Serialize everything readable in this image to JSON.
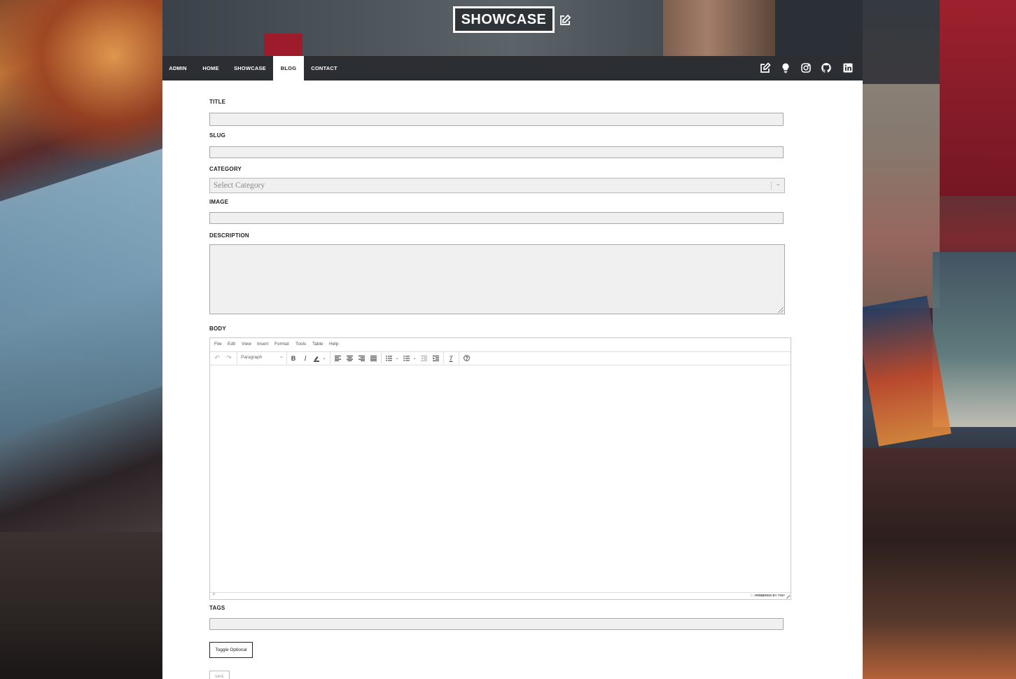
{
  "brand": {
    "title": "SHOWCASE"
  },
  "nav": {
    "items": [
      {
        "label": "ADMIN"
      },
      {
        "label": "HOME"
      },
      {
        "label": "SHOWCASE"
      },
      {
        "label": "BLOG",
        "active": true
      },
      {
        "label": "CONTACT"
      }
    ],
    "icons": [
      "edit-icon",
      "lightbulb-icon",
      "instagram-icon",
      "github-icon",
      "linkedin-icon"
    ]
  },
  "form": {
    "title_label": "TITLE",
    "slug_label": "SLUG",
    "category_label": "CATEGORY",
    "category_placeholder": "Select Category",
    "image_label": "IMAGE",
    "description_label": "DESCRIPTION",
    "body_label": "BODY",
    "tags_label": "TAGS",
    "toggle_button": "Toggle Optional",
    "submit_button": "SAVE"
  },
  "editor": {
    "menu": [
      "File",
      "Edit",
      "View",
      "Insert",
      "Format",
      "Tools",
      "Table",
      "Help"
    ],
    "format_select": "Paragraph",
    "status_path": "P",
    "word_count": "0 WORDS",
    "powered_by": "POWERED BY TINY"
  },
  "colors": {
    "nav_bg": "#282a2e",
    "panel_bg": "#ffffff",
    "input_bg": "#f0f0f0"
  }
}
